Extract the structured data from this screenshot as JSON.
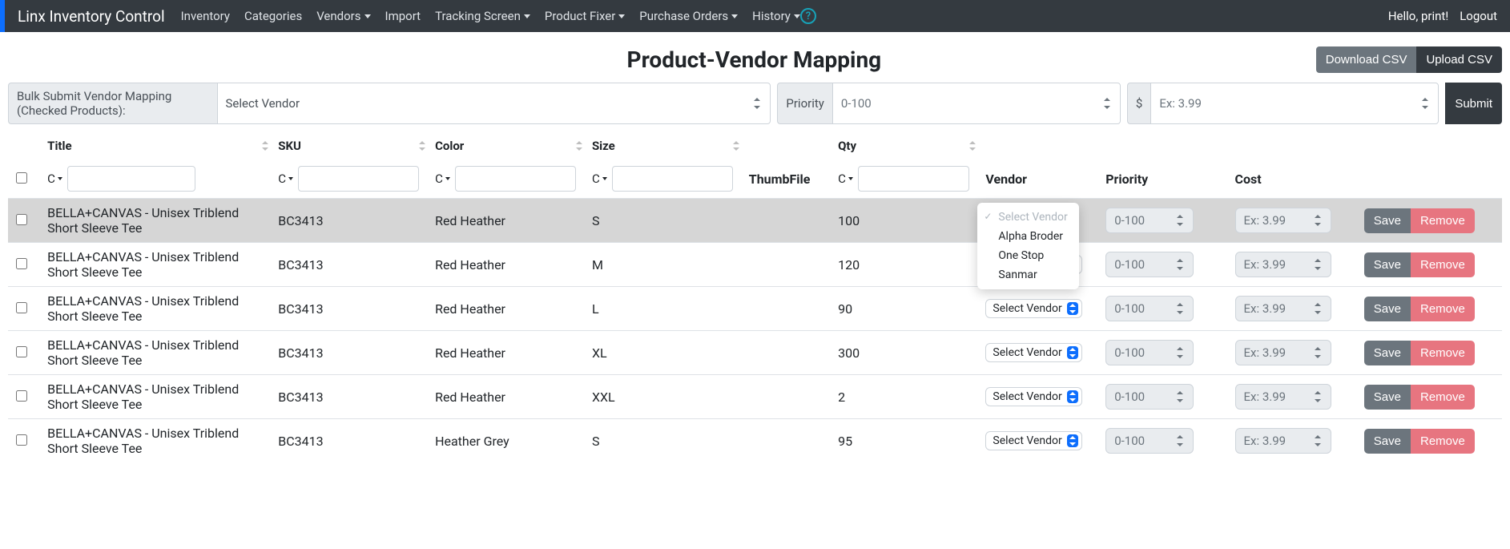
{
  "navbar": {
    "brand": "Linx Inventory Control",
    "items": [
      {
        "label": "Inventory",
        "dropdown": false
      },
      {
        "label": "Categories",
        "dropdown": false
      },
      {
        "label": "Vendors",
        "dropdown": true
      },
      {
        "label": "Import",
        "dropdown": false
      },
      {
        "label": "Tracking Screen",
        "dropdown": true
      },
      {
        "label": "Product Fixer",
        "dropdown": true
      },
      {
        "label": "Purchase Orders",
        "dropdown": true
      },
      {
        "label": "History",
        "dropdown": true
      }
    ],
    "help": "?",
    "greeting": "Hello, print!",
    "logout": "Logout"
  },
  "page": {
    "title": "Product-Vendor Mapping",
    "download_csv": "Download CSV",
    "upload_csv": "Upload CSV"
  },
  "bulk": {
    "label": "Bulk Submit Vendor Mapping (Checked Products):",
    "vendor_placeholder": "Select Vendor",
    "priority_label": "Priority",
    "priority_placeholder": "0-100",
    "cost_symbol": "$",
    "cost_placeholder": "Ex: 3.99",
    "submit": "Submit"
  },
  "table": {
    "headers": {
      "title": "Title",
      "sku": "SKU",
      "color": "Color",
      "size": "Size",
      "thumb": "ThumbFile",
      "qty": "Qty",
      "vendor": "Vendor",
      "priority": "Priority",
      "cost": "Cost"
    },
    "filter_c": "C",
    "vendor_select_label": "Select Vendor",
    "priority_placeholder": "0-100",
    "cost_placeholder": "Ex: 3.99",
    "save": "Save",
    "remove": "Remove",
    "rows": [
      {
        "title": "BELLA+CANVAS - Unisex Triblend Short Sleeve Tee",
        "sku": "BC3413",
        "color": "Red Heather",
        "size": "S",
        "qty": "100",
        "selected": true,
        "dropdown_open": true
      },
      {
        "title": "BELLA+CANVAS - Unisex Triblend Short Sleeve Tee",
        "sku": "BC3413",
        "color": "Red Heather",
        "size": "M",
        "qty": "120",
        "selected": false
      },
      {
        "title": "BELLA+CANVAS - Unisex Triblend Short Sleeve Tee",
        "sku": "BC3413",
        "color": "Red Heather",
        "size": "L",
        "qty": "90",
        "selected": false
      },
      {
        "title": "BELLA+CANVAS - Unisex Triblend Short Sleeve Tee",
        "sku": "BC3413",
        "color": "Red Heather",
        "size": "XL",
        "qty": "300",
        "selected": false
      },
      {
        "title": "BELLA+CANVAS - Unisex Triblend Short Sleeve Tee",
        "sku": "BC3413",
        "color": "Red Heather",
        "size": "XXL",
        "qty": "2",
        "selected": false
      },
      {
        "title": "BELLA+CANVAS - Unisex Triblend Short Sleeve Tee",
        "sku": "BC3413",
        "color": "Heather Grey",
        "size": "S",
        "qty": "95",
        "selected": false
      }
    ]
  },
  "vendor_dropdown": {
    "items": [
      "Select Vendor",
      "Alpha Broder",
      "One Stop",
      "Sanmar"
    ],
    "selected": "Select Vendor"
  }
}
